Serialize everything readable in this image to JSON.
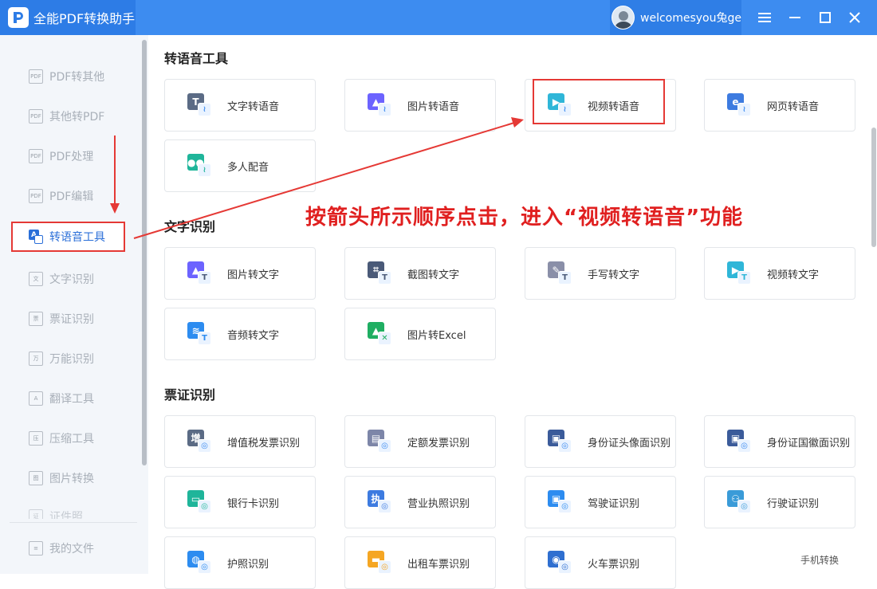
{
  "app": {
    "title": "全能PDF转换助手",
    "username": "welcomesyou兔ge"
  },
  "colors": {
    "brand": "#3d8cf0",
    "annotation_red": "#e53935",
    "active_text": "#2b6fd8"
  },
  "sidebar": {
    "items": [
      {
        "label": "PDF转其他",
        "icon": "pdf-export-icon"
      },
      {
        "label": "其他转PDF",
        "icon": "pdf-import-icon"
      },
      {
        "label": "PDF处理",
        "icon": "pdf-process-icon"
      },
      {
        "label": "PDF编辑",
        "icon": "pdf-edit-icon"
      },
      {
        "label": "转语音工具",
        "icon": "text-to-speech-icon",
        "active": true
      },
      {
        "label": "文字识别",
        "icon": "ocr-icon"
      },
      {
        "label": "票证识别",
        "icon": "ticket-icon"
      },
      {
        "label": "万能识别",
        "icon": "universal-scan-icon"
      },
      {
        "label": "翻译工具",
        "icon": "translate-icon"
      },
      {
        "label": "压缩工具",
        "icon": "compress-icon"
      },
      {
        "label": "图片转换",
        "icon": "image-convert-icon"
      },
      {
        "label": "证件照",
        "icon": "id-photo-icon"
      }
    ],
    "my_files": "我的文件"
  },
  "sections": {
    "speech": {
      "title": "转语音工具",
      "tools": [
        {
          "label": "文字转语音",
          "icon": "text-speech-icon"
        },
        {
          "label": "图片转语音",
          "icon": "image-speech-icon"
        },
        {
          "label": "视频转语音",
          "icon": "video-speech-icon"
        },
        {
          "label": "网页转语音",
          "icon": "web-speech-icon"
        },
        {
          "label": "多人配音",
          "icon": "multi-voice-icon"
        }
      ]
    },
    "ocr": {
      "title": "文字识别",
      "tools": [
        {
          "label": "图片转文字",
          "icon": "image-text-icon"
        },
        {
          "label": "截图转文字",
          "icon": "screenshot-text-icon"
        },
        {
          "label": "手写转文字",
          "icon": "handwriting-text-icon"
        },
        {
          "label": "视频转文字",
          "icon": "video-text-icon"
        },
        {
          "label": "音频转文字",
          "icon": "audio-text-icon"
        },
        {
          "label": "图片转Excel",
          "icon": "image-excel-icon"
        }
      ]
    },
    "ticket": {
      "title": "票证识别",
      "tools": [
        {
          "label": "增值税发票识别",
          "icon": "vat-invoice-icon"
        },
        {
          "label": "定额发票识别",
          "icon": "fixed-invoice-icon"
        },
        {
          "label": "身份证头像面识别",
          "icon": "id-front-icon"
        },
        {
          "label": "身份证国徽面识别",
          "icon": "id-back-icon"
        },
        {
          "label": "银行卡识别",
          "icon": "bank-card-icon"
        },
        {
          "label": "营业执照识别",
          "icon": "business-license-icon"
        },
        {
          "label": "驾驶证识别",
          "icon": "driver-license-icon"
        },
        {
          "label": "行驶证识别",
          "icon": "vehicle-license-icon"
        },
        {
          "label": "护照识别",
          "icon": "passport-icon"
        },
        {
          "label": "出租车票识别",
          "icon": "taxi-ticket-icon"
        },
        {
          "label": "火车票识别",
          "icon": "train-ticket-icon"
        }
      ]
    }
  },
  "annotation": {
    "text": "按箭头所示顺序点击，进入“视频转语音”功能"
  },
  "footer": {
    "mobile_switch": "手机转换"
  }
}
